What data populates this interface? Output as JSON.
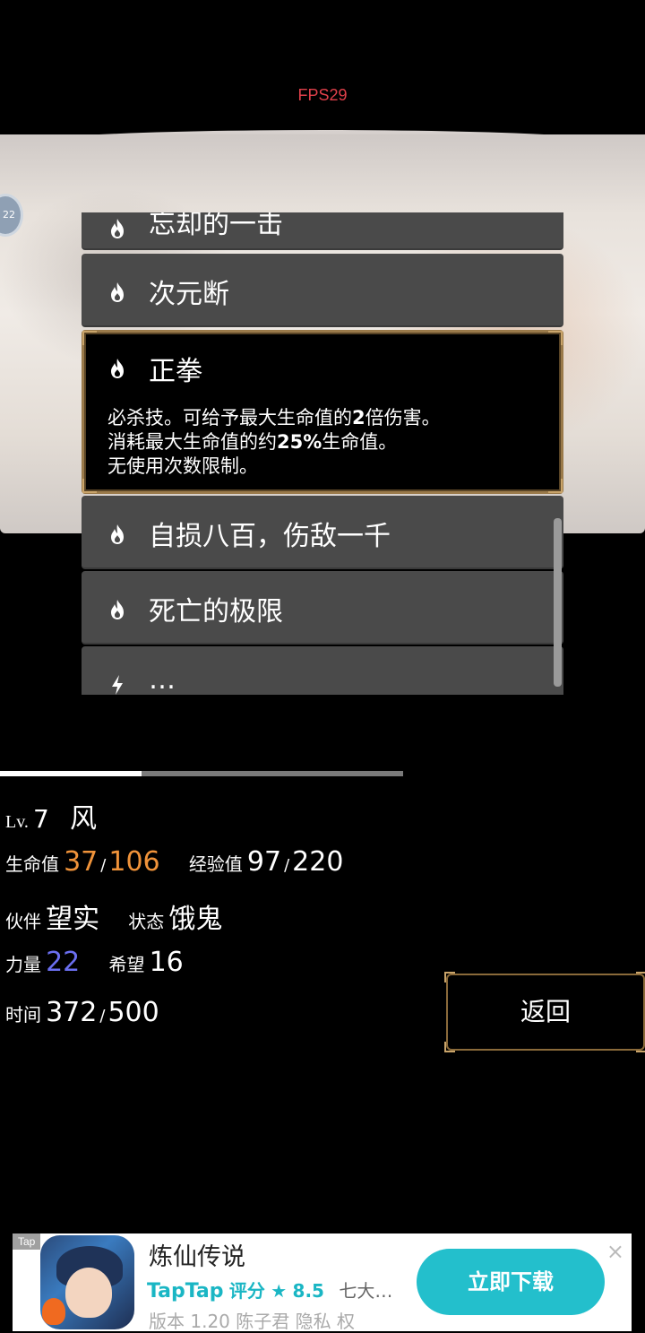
{
  "hud": {
    "fps": "FPS29"
  },
  "side_badge": {
    "text": "22"
  },
  "skills": [
    {
      "name": "忘却的一击",
      "icon": "flame-icon"
    },
    {
      "name": "次元断",
      "icon": "flame-icon"
    },
    {
      "name": "正拳",
      "icon": "flame-icon",
      "selected": true,
      "desc_line1_a": "必杀技。可给予最大生命值的",
      "desc_line1_b": "2",
      "desc_line1_c": "倍伤害。",
      "desc_line2_a": "消耗最大生命值的约",
      "desc_line2_b": "25%",
      "desc_line2_c": "生命值。",
      "desc_line3": "无使用次数限制。"
    },
    {
      "name": "自损八百，伤敌一千",
      "icon": "flame-icon"
    },
    {
      "name": "死亡的极限",
      "icon": "flame-icon"
    },
    {
      "name": "…",
      "icon": "lightning-icon"
    }
  ],
  "progress": {
    "fraction": 0.35
  },
  "stats": {
    "lv_label": "Lv.",
    "lv_value": "7",
    "element": "风",
    "hp_label": "生命值",
    "hp_cur": "37",
    "hp_max": "106",
    "exp_label": "经验值",
    "exp_cur": "97",
    "exp_max": "220",
    "partner_label": "伙伴",
    "partner_value": "望实",
    "status_label": "状态",
    "status_value": "饿鬼",
    "str_label": "力量",
    "str_value": "22",
    "hope_label": "希望",
    "hope_value": "16",
    "time_label": "时间",
    "time_cur": "372",
    "time_max": "500",
    "slash": "/"
  },
  "buttons": {
    "back": "返回"
  },
  "ad": {
    "tag": "Tap",
    "title": "炼仙传说",
    "brand": "TapTap",
    "rating_label": "评分",
    "star": "★",
    "score": "8.5",
    "more": "七大…",
    "meta": "版本 1.20   陈子君   隐私   权",
    "download": "立即下载",
    "close": "×"
  }
}
